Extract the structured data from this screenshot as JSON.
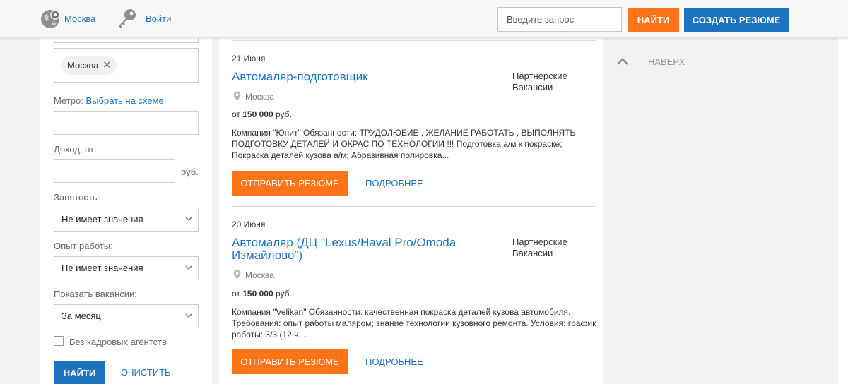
{
  "header": {
    "city_link": "Москва",
    "login_link": "Войти",
    "search_placeholder": "Введите запрос",
    "find_button": "НАЙТИ",
    "create_resume_button": "СОЗДАТЬ РЕЗЮМЕ"
  },
  "filters": {
    "city_chip": "Москва",
    "metro_label": "Метро:",
    "metro_link": "Выбрать на схеме",
    "income_label": "Доход, от:",
    "income_unit": "руб.",
    "employment_label": "Занятость:",
    "employment_value": "Не имеет значения",
    "experience_label": "Опыт работы:",
    "experience_value": "Не имеет значения",
    "period_label": "Показать вакансии:",
    "period_value": "За месяц",
    "no_agencies_label": "Без кадровых агентств",
    "find_button": "НАЙТИ",
    "clear_link": "ОЧИСТИТЬ"
  },
  "vacancies": [
    {
      "date": "21 Июня",
      "title": "Автомаляр-подготовщик",
      "source": "Партнерские Вакансии",
      "location": "Москва",
      "salary_prefix": "от",
      "salary_amount": "150 000",
      "salary_unit": "руб.",
      "description": "Компания \"Юнит\" Обязанности: ТРУДОЛЮБИЕ , ЖЕЛАНИЕ РАБОТАТЬ , ВЫПОЛНЯТЬ ПОДГОТОВКУ ДЕТАЛЕЙ И ОКРАС ПО ТЕХНОЛОГИИ !!! Подготовка а/м к покраске; Покраска деталей кузова а/м; Абразивная полировка...",
      "send_button": "ОТПРАВИТЬ РЕЗЮМЕ",
      "more_link": "ПОДРОБНЕЕ"
    },
    {
      "date": "20 Июня",
      "title": "Автомаляр (ДЦ \"Lexus/Haval Pro/Omoda Измайлово\")",
      "source": "Партнерские Вакансии",
      "location": "Москва",
      "salary_prefix": "от",
      "salary_amount": "150 000",
      "salary_unit": "руб.",
      "description": "Компания \"Velikan\" Обязанности: качественная покраска деталей кузова автомобиля. Требования: опыт работы маляром; знание технологии кузовного ремонта. Условия: график работы: 3/3 (12 ч....",
      "send_button": "ОТПРАВИТЬ РЕЗЮМЕ",
      "more_link": "ПОДРОБНЕЕ"
    }
  ],
  "up_link": "НАВЕРХ",
  "colors": {
    "accent_blue": "#1e73be",
    "accent_orange": "#ff7418"
  }
}
